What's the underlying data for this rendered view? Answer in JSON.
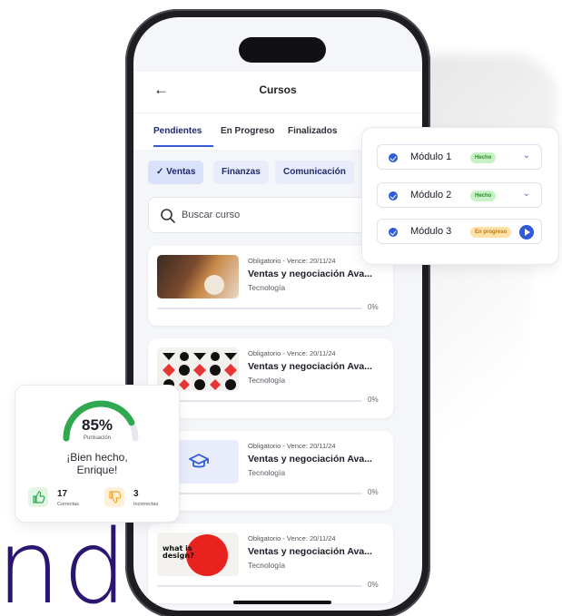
{
  "brand": {
    "partial_wordmark": "nd"
  },
  "app": {
    "title": "Cursos",
    "back_icon": "arrow-left-icon",
    "tabs": [
      {
        "label": "Pendientes",
        "active": true
      },
      {
        "label": "En Progreso",
        "active": false
      },
      {
        "label": "Finalizados",
        "active": false
      }
    ],
    "chips": [
      {
        "label": "✓ Ventas",
        "selected": true
      },
      {
        "label": "Finanzas",
        "selected": false
      },
      {
        "label": "Comunicación",
        "selected": false
      }
    ],
    "search": {
      "placeholder": "Buscar curso"
    },
    "courses": [
      {
        "meta": "Obligatorio - Vence: 20/11/24",
        "title": "Ventas y negociación Ava...",
        "category": "Tecnología",
        "progress": "0%",
        "thumb": "laptop-photo"
      },
      {
        "meta": "Obligatorio - Vence: 20/11/24",
        "title": "Ventas y negociación Ava...",
        "category": "Tecnología",
        "progress": "0%",
        "thumb": "pattern-shapes"
      },
      {
        "meta": "Obligatorio - Vence: 20/11/24",
        "title": "Ventas y negociación Ava...",
        "category": "Tecnología",
        "progress": "0%",
        "thumb": "graduation-cap-icon"
      },
      {
        "meta": "Obligatorio - Vence: 20/11/24",
        "title": "Ventas y negociación Ava...",
        "category": "Tecnología",
        "progress": "0%",
        "thumb": "what-is-design",
        "thumb_text": "what is design?"
      }
    ]
  },
  "modules": [
    {
      "label": "Módulo 1",
      "badge": "Hecho",
      "status": "done"
    },
    {
      "label": "Módulo 2",
      "badge": "Hecho",
      "status": "done"
    },
    {
      "label": "Módulo 3",
      "badge": "En progreso",
      "status": "progress"
    }
  ],
  "score": {
    "value": "85%",
    "fraction": 0.85,
    "label": "Puntuación",
    "message": "¡Bien hecho, Enrique!",
    "correct": {
      "count": "17",
      "label": "Correctas"
    },
    "incorrect": {
      "count": "3",
      "label": "Incorrectas"
    }
  },
  "colors": {
    "accent": "#3759d6",
    "brand_dark": "#2a1670",
    "success": "#2fa84f",
    "warning": "#f5a623"
  }
}
